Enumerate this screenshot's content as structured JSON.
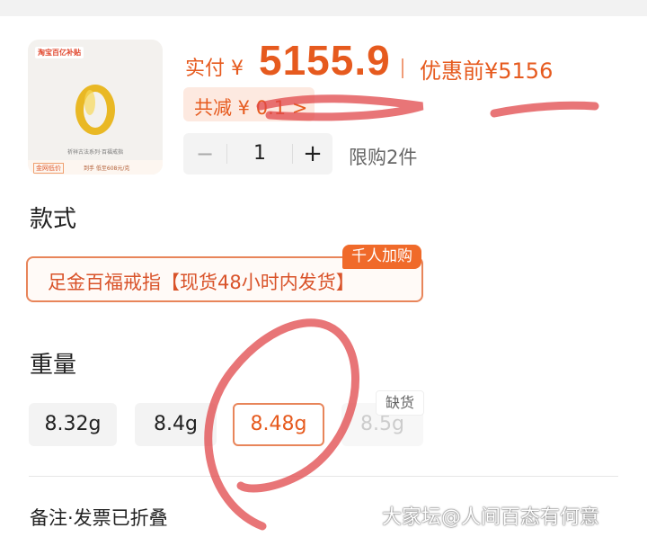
{
  "product": {
    "thumb_tag": "淘宝百亿补贴",
    "thumb_series": "祈祥古法系列·百福戒指",
    "thumb_strip_a": "金网低价",
    "thumb_strip_b": "到手 低至608元/克"
  },
  "price": {
    "paid_label": "实付 ¥",
    "paid_value": "5155.9",
    "original_label": "优惠前¥5156",
    "discount_label": "共减 ¥ 0.1 >"
  },
  "quantity": {
    "minus": "−",
    "value": "1",
    "plus": "+",
    "limit": "限购2件"
  },
  "style": {
    "heading": "款式",
    "option": "足金百福戒指【现货48小时内发货】",
    "hot_badge": "千人加购"
  },
  "weight": {
    "heading": "重量",
    "options": [
      "8.32g",
      "8.4g",
      "8.48g",
      "8.5g"
    ],
    "selected": "8.48g",
    "out_of_stock_badge": "缺货"
  },
  "footer": {
    "remark": "备注·发票已折叠",
    "watermark": "大家坛@人间百态有何意"
  },
  "colors": {
    "accent": "#e65a1e",
    "annotation": "#e0474a"
  }
}
